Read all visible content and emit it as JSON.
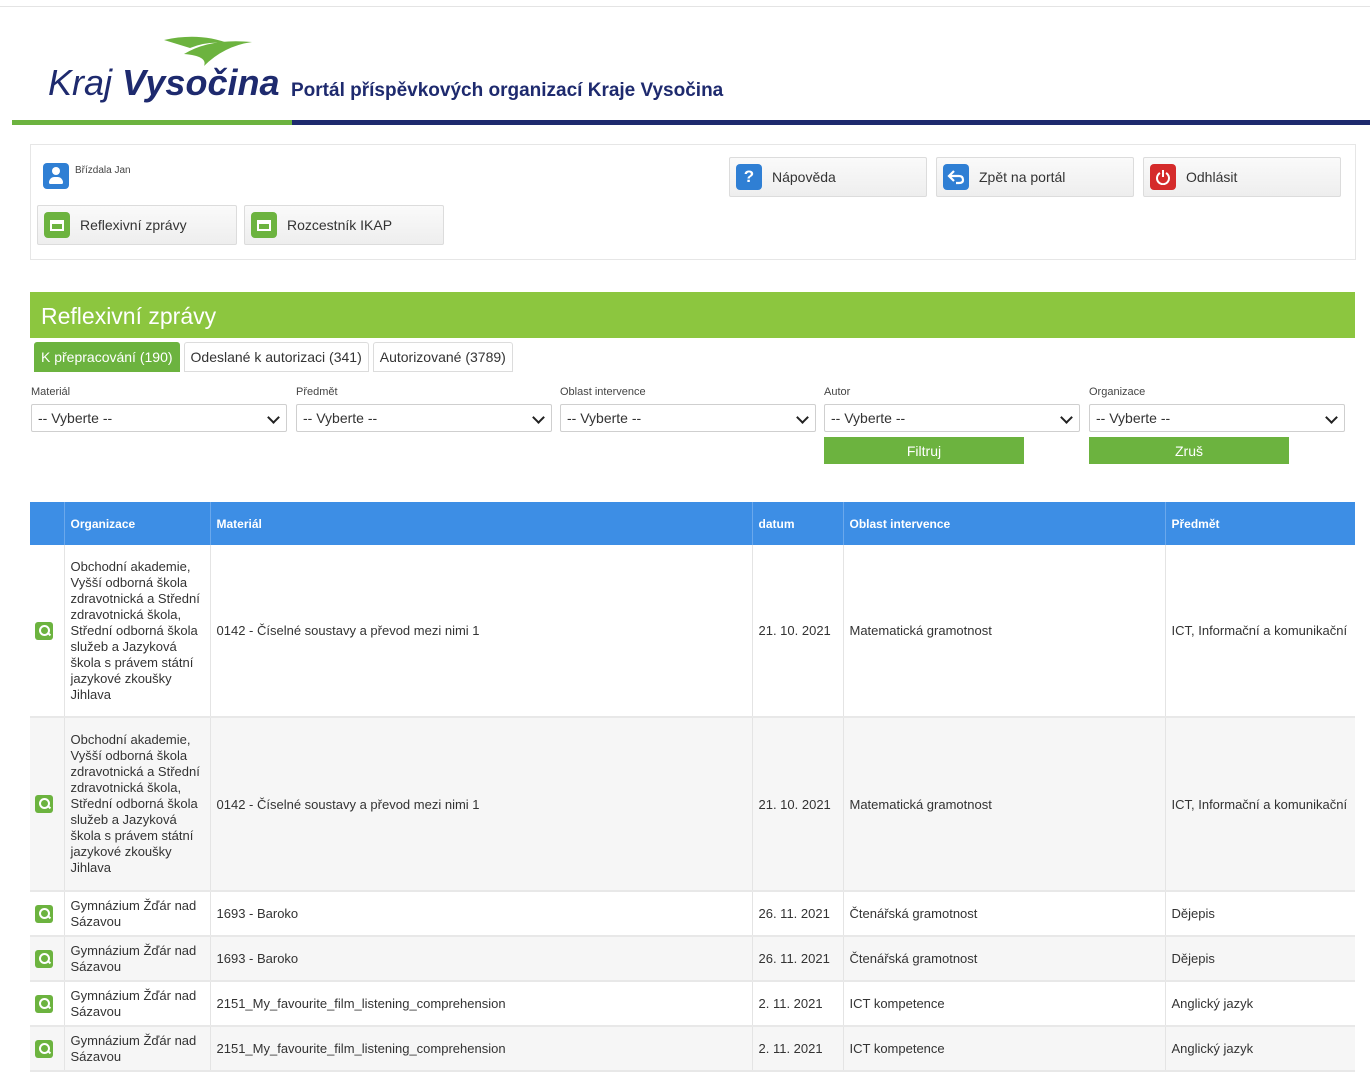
{
  "header": {
    "logo_light": "Kraj",
    "logo_bold": "Vysočina",
    "portal_title": "Portál příspěvkových organizací Kraje Vysočina",
    "brand_green": "#6cb33f",
    "brand_blue": "#1e2a6e"
  },
  "toolbar": {
    "user_name": "Břízdala Jan",
    "help": "Nápověda",
    "back": "Zpět na portál",
    "logout": "Odhlásit",
    "reflexive_reports": "Reflexivní zprávy",
    "ikap_directory": "Rozcestník IKAP",
    "icons": {
      "help": "question-icon",
      "back": "back-arrow-icon",
      "logout": "power-icon",
      "user": "user-icon",
      "window": "window-icon"
    }
  },
  "section": {
    "title": "Reflexivní zprávy"
  },
  "tabs": [
    {
      "label": "K přepracování (190)",
      "active": true
    },
    {
      "label": "Odeslané k autorizaci (341)",
      "active": false
    },
    {
      "label": "Autorizované (3789)",
      "active": false
    }
  ],
  "filters": {
    "material": {
      "label": "Materiál",
      "value": "-- Vyberte --"
    },
    "subject": {
      "label": "Předmět",
      "value": "-- Vyberte --"
    },
    "area": {
      "label": "Oblast intervence",
      "value": "-- Vyberte --"
    },
    "author": {
      "label": "Autor",
      "value": "-- Vyberte --"
    },
    "organization": {
      "label": "Organizace",
      "value": "-- Vyberte --"
    },
    "filter_button": "Filtruj",
    "cancel_button": "Zruš"
  },
  "table": {
    "columns": [
      "Organizace",
      "Materiál",
      "datum",
      "Oblast intervence",
      "Předmět"
    ],
    "rows": [
      {
        "org": "Obchodní akademie, Vyšší odborná škola zdravotnická a Střední zdravotnická škola, Střední odborná škola služeb a Jazyková škola s právem státní jazykové zkoušky Jihlava",
        "material": "0142 - Číselné soustavy a převod mezi nimi 1",
        "date": "21. 10. 2021",
        "area": "Matematická gramotnost",
        "subject": "ICT, Informační a komunikační"
      },
      {
        "org": "Obchodní akademie, Vyšší odborná škola zdravotnická a Střední zdravotnická škola, Střední odborná škola služeb a Jazyková škola s právem státní jazykové zkoušky Jihlava",
        "material": "0142 - Číselné soustavy a převod mezi nimi 1",
        "date": "21. 10. 2021",
        "area": "Matematická gramotnost",
        "subject": "ICT, Informační a komunikační"
      },
      {
        "org": "Gymnázium Žďár nad Sázavou",
        "material": "1693 - Baroko",
        "date": "26. 11. 2021",
        "area": "Čtenářská gramotnost",
        "subject": "Dějepis"
      },
      {
        "org": "Gymnázium Žďár nad Sázavou",
        "material": "1693 - Baroko",
        "date": "26. 11. 2021",
        "area": "Čtenářská gramotnost",
        "subject": "Dějepis"
      },
      {
        "org": "Gymnázium Žďár nad Sázavou",
        "material": "2151_My_favourite_film_listening_comprehension",
        "date": "2. 11. 2021",
        "area": "ICT kompetence",
        "subject": "Anglický jazyk"
      },
      {
        "org": "Gymnázium Žďár nad Sázavou",
        "material": "2151_My_favourite_film_listening_comprehension",
        "date": "2. 11. 2021",
        "area": "ICT kompetence",
        "subject": "Anglický jazyk"
      }
    ]
  }
}
